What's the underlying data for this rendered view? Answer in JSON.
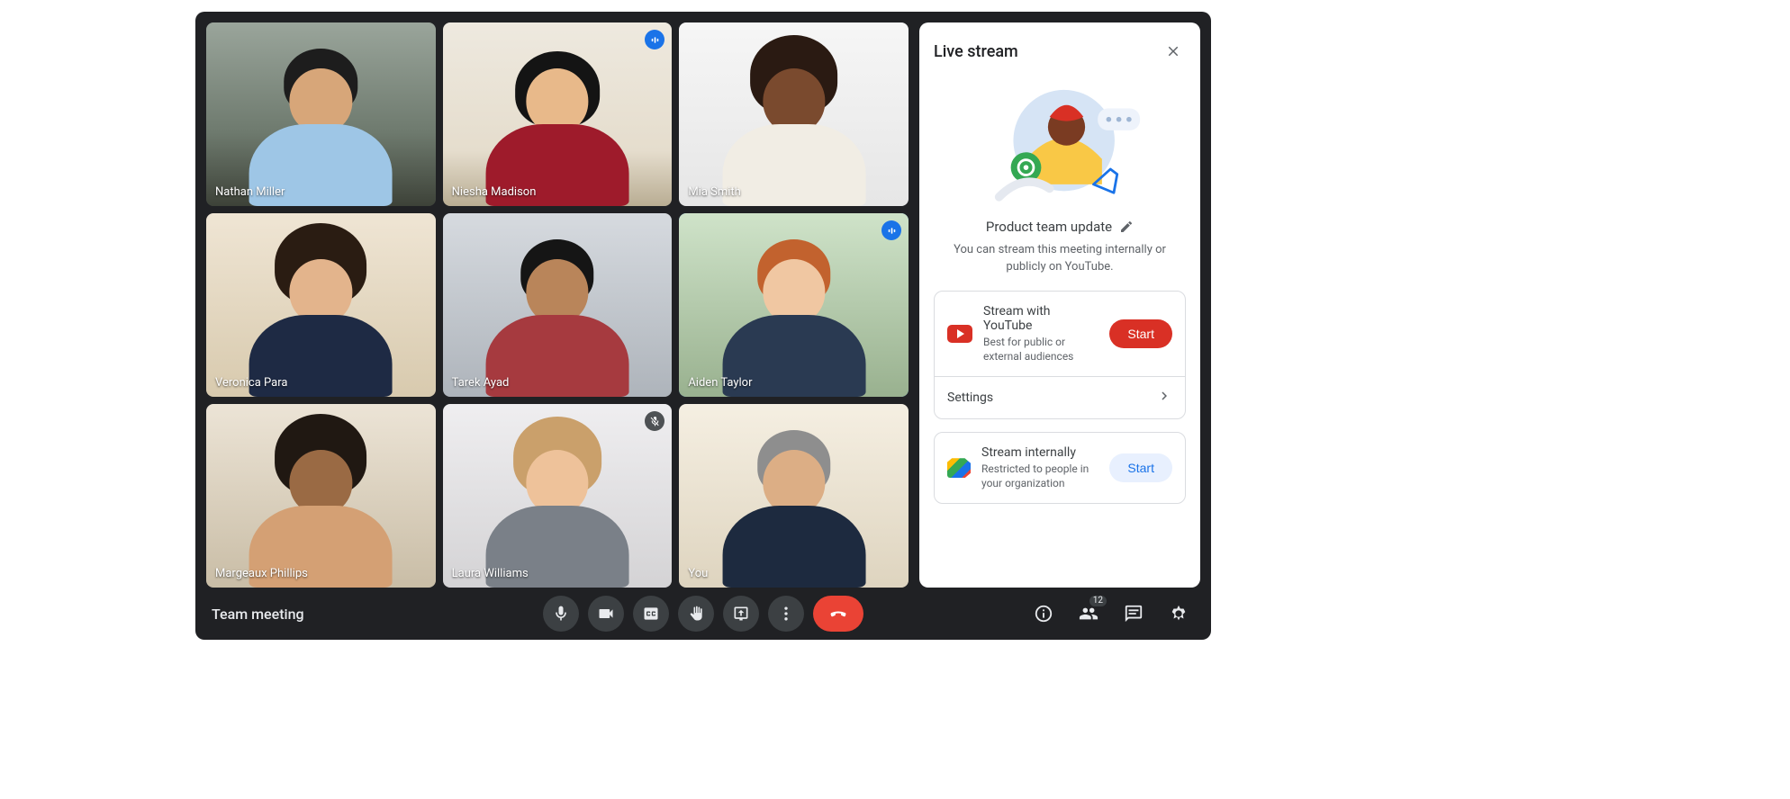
{
  "meeting_name": "Team meeting",
  "participant_count": "12",
  "participants": [
    {
      "name": "Nathan Miller"
    },
    {
      "name": "Niesha Madison"
    },
    {
      "name": "Mia Smith"
    },
    {
      "name": "Veronica Para"
    },
    {
      "name": "Tarek Ayad"
    },
    {
      "name": "Aiden Taylor"
    },
    {
      "name": "Margeaux Phillips"
    },
    {
      "name": "Laura Williams"
    },
    {
      "name": "You"
    }
  ],
  "panel": {
    "title": "Live stream",
    "stream_name": "Product team update",
    "description": "You can stream this meeting internally or publicly on YouTube.",
    "youtube": {
      "title": "Stream with YouTube",
      "subtitle": "Best for public or external audiences",
      "button": "Start"
    },
    "settings_label": "Settings",
    "internal": {
      "title": "Stream internally",
      "subtitle": "Restricted to people in your organization",
      "button": "Start"
    }
  }
}
